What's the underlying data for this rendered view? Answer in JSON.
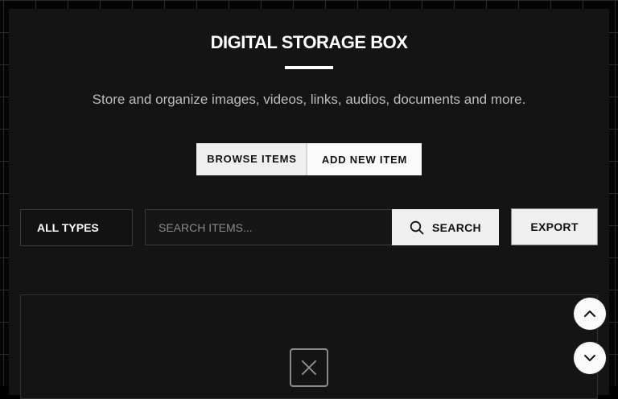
{
  "header": {
    "title": "DIGITAL STORAGE BOX",
    "subtitle": "Store and organize images, videos, links, audios, documents and more."
  },
  "actions": {
    "browse_label": "BROWSE ITEMS",
    "add_label": "ADD NEW ITEM"
  },
  "toolbar": {
    "type_filter_value": "ALL TYPES",
    "search_placeholder": "SEARCH ITEMS...",
    "search_value": "",
    "search_button_label": "SEARCH",
    "export_label": "EXPORT"
  },
  "content": {
    "empty_icon": "close-box-icon"
  },
  "scroll": {
    "up_icon": "chevron-up-icon",
    "down_icon": "chevron-down-icon"
  },
  "colors": {
    "background": "#050505",
    "panel": "#141414",
    "accent_light": "#efefef",
    "text_muted": "#bdbdbd"
  }
}
